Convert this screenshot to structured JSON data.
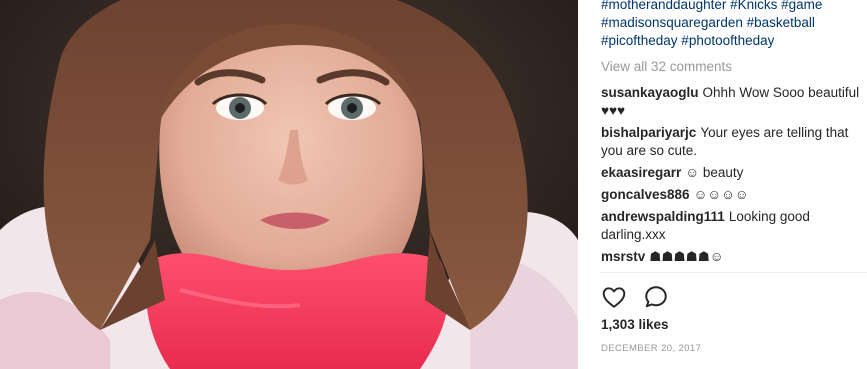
{
  "post": {
    "hashtags": [
      "#motheranddaughter #Knicks #game",
      "#madisonsquaregarden #basketball",
      "#picoftheday #photooftheday"
    ],
    "view_all_comments": "View all 32 comments",
    "comments": [
      {
        "user": "susankayaoglu",
        "text": "Ohhh Wow Sooo beautiful ♥♥♥"
      },
      {
        "user": "bishalpariyarjc",
        "text": "Your eyes are telling that you are so cute."
      },
      {
        "user": "ekaasiregarr",
        "text": "☺ beauty"
      },
      {
        "user": "goncalves886",
        "text": "☺☺☺☺"
      },
      {
        "user": "andrewspalding111",
        "text": "Looking good darling.xxx"
      },
      {
        "user": "msrstv",
        "text": "☗☗☗☗☗☺"
      }
    ],
    "likes": "1,303 likes",
    "date": "DECEMBER 20, 2017"
  },
  "icons": {
    "like": "heart-icon",
    "comment": "comment-bubble-icon"
  }
}
